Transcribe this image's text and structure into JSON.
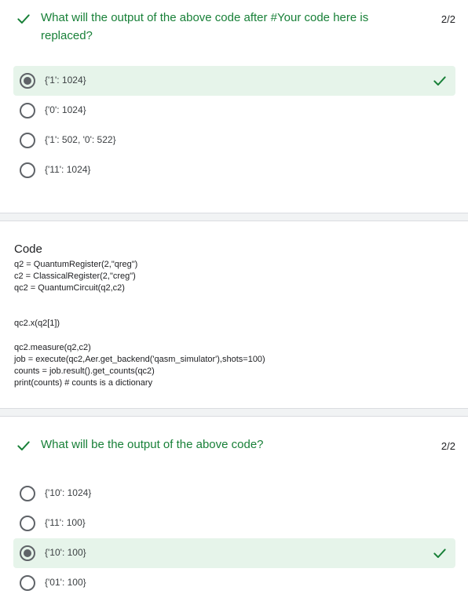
{
  "colors": {
    "accent_green": "#188038",
    "correct_bg": "#e6f4ea",
    "divider": "#f1f3f4"
  },
  "question1": {
    "title": "What will the output of the above code after #Your code here is replaced?",
    "score": "2/2",
    "status_icon": "check-icon",
    "options": [
      {
        "label": "{'1': 1024}",
        "selected": true,
        "correct": true
      },
      {
        "label": "{'0': 1024}",
        "selected": false,
        "correct": false
      },
      {
        "label": "{'1': 502, '0': 522}",
        "selected": false,
        "correct": false
      },
      {
        "label": "{'11': 1024}",
        "selected": false,
        "correct": false
      }
    ]
  },
  "code_section": {
    "title": "Code",
    "lines": [
      "q2 = QuantumRegister(2,\"qreg\")",
      "c2 = ClassicalRegister(2,\"creg\")",
      "qc2 = QuantumCircuit(q2,c2)",
      "qc2.x(q2[1])",
      "qc2.measure(q2,c2)",
      "job = execute(qc2,Aer.get_backend('qasm_simulator'),shots=100)",
      "counts = job.result().get_counts(qc2)",
      "print(counts) # counts is a dictionary"
    ]
  },
  "question2": {
    "title": "What will be the output of the above code?",
    "score": "2/2",
    "status_icon": "check-icon",
    "options": [
      {
        "label": "{'10': 1024}",
        "selected": false,
        "correct": false
      },
      {
        "label": "{'11': 100}",
        "selected": false,
        "correct": false
      },
      {
        "label": "{'10': 100}",
        "selected": true,
        "correct": true
      },
      {
        "label": "{'01': 100}",
        "selected": false,
        "correct": false
      }
    ]
  }
}
